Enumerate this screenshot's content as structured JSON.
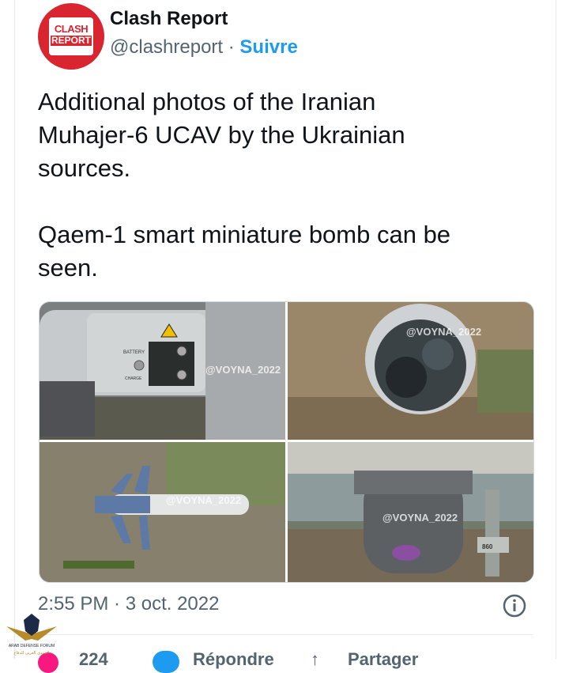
{
  "account": {
    "avatar_line1": "CLASH",
    "avatar_line2": "REPORT",
    "name": "Clash Report",
    "handle": "@clashreport",
    "separator": " · ",
    "follow_label": "Suivre"
  },
  "tweet": {
    "text": "Additional photos of the Iranian\nMuhajer-6 UCAV by the Ukrainian\nsources.\n\nQaem-1 smart miniature bomb can be\nseen."
  },
  "media": {
    "watermarks": [
      "@VOYNA_2022",
      "@VOYNA_2022",
      "@VOYNA_2022",
      "@VOYNA_2022"
    ],
    "labels": {
      "battery": "BATTERY",
      "charge": "CHARGE",
      "tag": "860"
    }
  },
  "meta": {
    "timestamp": "2:55 PM · 3 oct. 2022",
    "info_icon": "info-circle-icon"
  },
  "actions": {
    "likes": "224",
    "reply_label": "Répondre",
    "share_label": "Partager"
  },
  "forum_logo": {
    "line1": "ARAB DEFENSE FORUM",
    "line2": "المنتدى العربي للدفاع"
  },
  "colors": {
    "accent": "#1d9bf0",
    "brand": "#d9252f",
    "text": "#0f1419",
    "secondary": "#536471"
  }
}
